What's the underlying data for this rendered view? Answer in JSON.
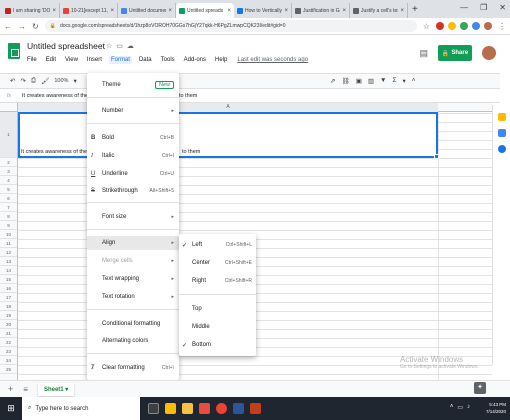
{
  "browser": {
    "tabs": [
      {
        "title": "I am sharing 'DOIN",
        "color": "#c5221f"
      },
      {
        "title": "10-21[except 11,",
        "color": "#ea4335"
      },
      {
        "title": "Untitled documen",
        "color": "#4285f4"
      },
      {
        "title": "Untitled spreads",
        "color": "#0f9d58",
        "active": true
      },
      {
        "title": "How to Vertically",
        "color": "#1a73e8"
      },
      {
        "title": "Justification in Go",
        "color": "#5f6368"
      },
      {
        "title": "Justify a cell's text",
        "color": "#5f6368"
      }
    ],
    "new_tab": "+",
    "url": "docs.google.com/spreadsheets/d/1hzp8oVOROH70GGs7hGjY27qkk-H6PgZLmwpCQK23I/edit#gid=0",
    "win_controls": [
      "—",
      "❐",
      "✕"
    ]
  },
  "sheets": {
    "doc_title": "Untitled spreadsheet",
    "menu": [
      "File",
      "Edit",
      "View",
      "Insert",
      "Format",
      "Data",
      "Tools",
      "Add-ons",
      "Help"
    ],
    "last_edit": "Last edit was seconds ago",
    "share_label": "Share",
    "zoom": "100%",
    "formula_value": "It creates awareness of the cha",
    "formula_value_tail": "to them",
    "column_a": "A",
    "cell_a1_text": "It creates awareness of the chal",
    "cell_a1_tail": "to them",
    "row_numbers": [
      "1",
      "2",
      "3",
      "4",
      "5",
      "6",
      "7",
      "8",
      "9",
      "10",
      "11",
      "12",
      "13",
      "14",
      "15",
      "16",
      "17",
      "18",
      "19",
      "20",
      "21",
      "22",
      "23",
      "24",
      "25"
    ]
  },
  "format_menu": {
    "theme": "Theme",
    "new_badge": "New",
    "number": "Number",
    "bold": "Bold",
    "bold_sc": "Ctrl+B",
    "italic": "Italic",
    "italic_sc": "Ctrl+I",
    "underline": "Underline",
    "underline_sc": "Ctrl+U",
    "strikethrough": "Strikethrough",
    "strikethrough_sc": "Alt+Shift+5",
    "font_size": "Font size",
    "align": "Align",
    "merge_cells": "Merge cells",
    "text_wrapping": "Text wrapping",
    "text_rotation": "Text rotation",
    "conditional_formatting": "Conditional formatting",
    "alternating_colors": "Alternating colors",
    "clear_formatting": "Clear formatting",
    "clear_formatting_sc": "Ctrl+\\"
  },
  "align_submenu": {
    "left": "Left",
    "left_sc": "Ctrl+Shift+L",
    "center": "Center",
    "center_sc": "Ctrl+Shift+E",
    "right": "Right",
    "right_sc": "Ctrl+Shift+R",
    "top": "Top",
    "middle": "Middle",
    "bottom": "Bottom"
  },
  "bottom": {
    "add_sheet": "+",
    "all_sheets": "≡",
    "sheet1": "Sheet1 ▾",
    "watermark_title": "Activate Windows",
    "watermark_sub": "Go to Settings to activate Windows."
  },
  "taskbar": {
    "search_placeholder": "Type here to search",
    "time": "5:43 PM",
    "date": "7/14/2020"
  }
}
